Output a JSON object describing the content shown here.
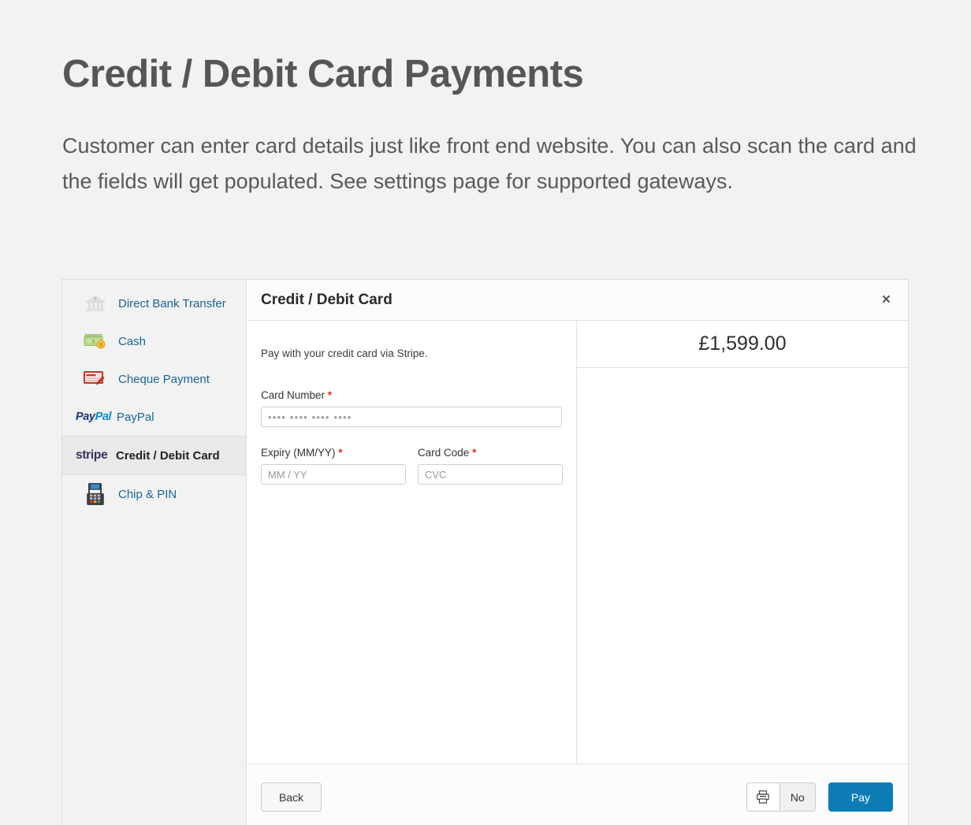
{
  "page": {
    "title": "Credit / Debit Card Payments",
    "description": "Customer can enter card details just like front end website. You can also scan the card and the fields will get populated. See settings page for supported gateways."
  },
  "methods": [
    {
      "label": "Direct Bank Transfer",
      "icon": "bank-icon",
      "active": false
    },
    {
      "label": "Cash",
      "icon": "cash-icon",
      "active": false
    },
    {
      "label": "Cheque Payment",
      "icon": "cheque-icon",
      "active": false
    },
    {
      "label": "PayPal",
      "icon": "paypal-logo",
      "active": false
    },
    {
      "label": "Credit / Debit Card",
      "icon": "stripe-logo",
      "active": true
    },
    {
      "label": "Chip & PIN",
      "icon": "card-terminal-icon",
      "active": false
    }
  ],
  "paypal_logo": {
    "part1": "Pay",
    "part2": "Pal"
  },
  "stripe_logo": {
    "text": "stripe"
  },
  "panel": {
    "title": "Credit / Debit Card",
    "close_label": "×"
  },
  "form": {
    "intro": "Pay with your credit card via Stripe.",
    "card_number": {
      "label": "Card Number",
      "required_mark": "*",
      "placeholder": "•••• •••• •••• ••••",
      "value": ""
    },
    "expiry": {
      "label": "Expiry (MM/YY)",
      "required_mark": "*",
      "placeholder": "MM / YY",
      "value": ""
    },
    "card_code": {
      "label": "Card Code",
      "required_mark": "*",
      "placeholder": "CVC",
      "value": ""
    }
  },
  "summary": {
    "amount": "£1,599.00"
  },
  "footer": {
    "back_label": "Back",
    "print_toggle_label": "No",
    "print_icon": "printer-icon",
    "pay_label": "Pay"
  },
  "colors": {
    "page_background": "#f2f2f2",
    "link_blue": "#1a6496",
    "pay_button": "#0d7cb5",
    "required_red": "#e02b27",
    "heading_gray": "#565656"
  }
}
